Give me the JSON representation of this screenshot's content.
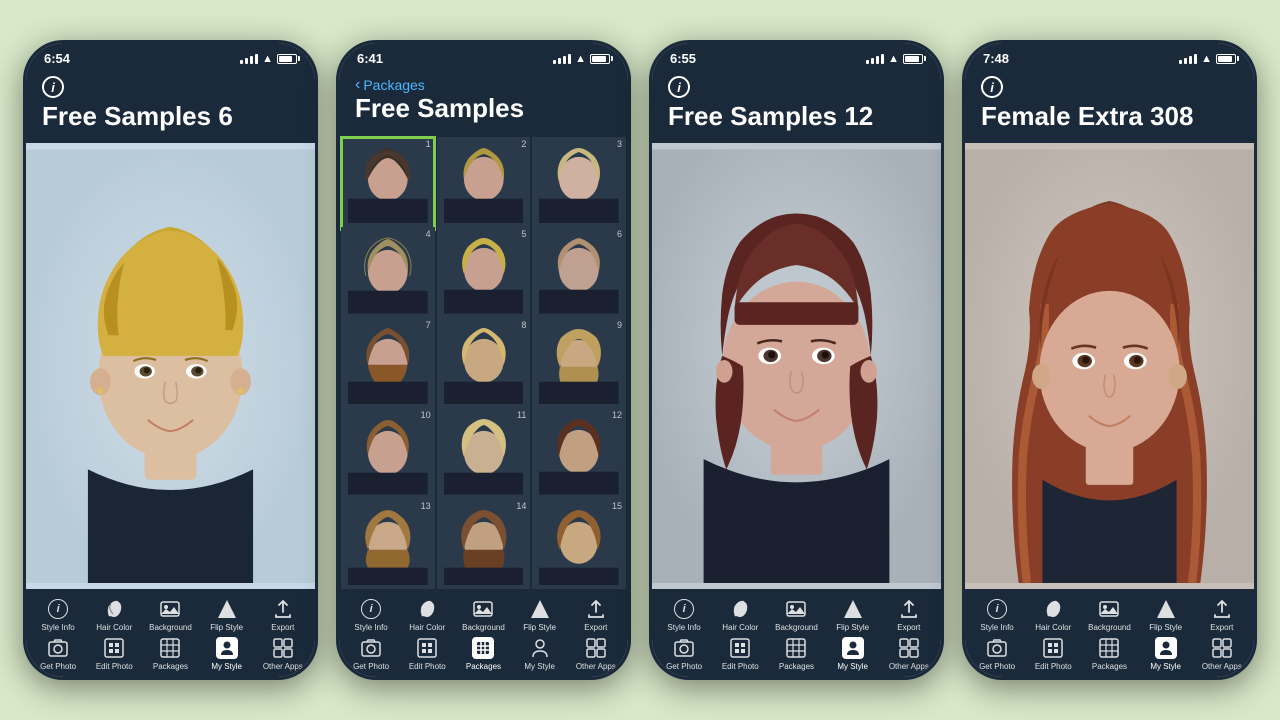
{
  "background_color": "#d8e8c8",
  "phones": [
    {
      "id": "phone1",
      "status_time": "6:54",
      "has_back": false,
      "title": "Free Samples 6",
      "screen_type": "portrait",
      "bottom_tabs_row1": [
        "Style Info",
        "Hair Color",
        "Background",
        "Flip Style",
        "Export"
      ],
      "bottom_tabs_row2": [
        "Get Photo",
        "Edit Photo",
        "Packages",
        "My Style",
        "Other Apps"
      ],
      "active_tab_row2": "My Style"
    },
    {
      "id": "phone2",
      "status_time": "6:41",
      "has_back": true,
      "back_label": "Packages",
      "title": "Free Samples",
      "screen_type": "grid",
      "grid_count": 15,
      "selected_item": 1,
      "bottom_tabs_row1": [
        "Style Info",
        "Hair Color",
        "Background",
        "Flip Style",
        "Export"
      ],
      "bottom_tabs_row2": [
        "Get Photo",
        "Edit Photo",
        "Packages",
        "My Style",
        "Other Apps"
      ],
      "active_tab_row2": "Packages"
    },
    {
      "id": "phone3",
      "status_time": "6:55",
      "has_back": false,
      "title": "Free Samples 12",
      "screen_type": "portrait2",
      "bottom_tabs_row1": [
        "Style Info",
        "Hair Color",
        "Background",
        "Flip Style",
        "Export"
      ],
      "bottom_tabs_row2": [
        "Get Photo",
        "Edit Photo",
        "Packages",
        "My Style",
        "Other Apps"
      ],
      "active_tab_row2": "My Style"
    },
    {
      "id": "phone4",
      "status_time": "7:48",
      "has_back": false,
      "title": "Female Extra 308",
      "screen_type": "portrait3",
      "bottom_tabs_row1": [
        "Style Info",
        "Hair Color",
        "Background",
        "Flip Style",
        "Export"
      ],
      "bottom_tabs_row2": [
        "Get Photo",
        "Edit Photo",
        "Packages",
        "My Style",
        "Other Apps"
      ],
      "active_tab_row2": "My Style"
    }
  ],
  "icons": {
    "info": "ℹ",
    "bucket": "🪣",
    "background": "🖼",
    "flip": "▲",
    "export": "↗",
    "camera": "📷",
    "edit": "⊞",
    "packages": "⊟",
    "person": "👤",
    "apps": "⊡"
  }
}
